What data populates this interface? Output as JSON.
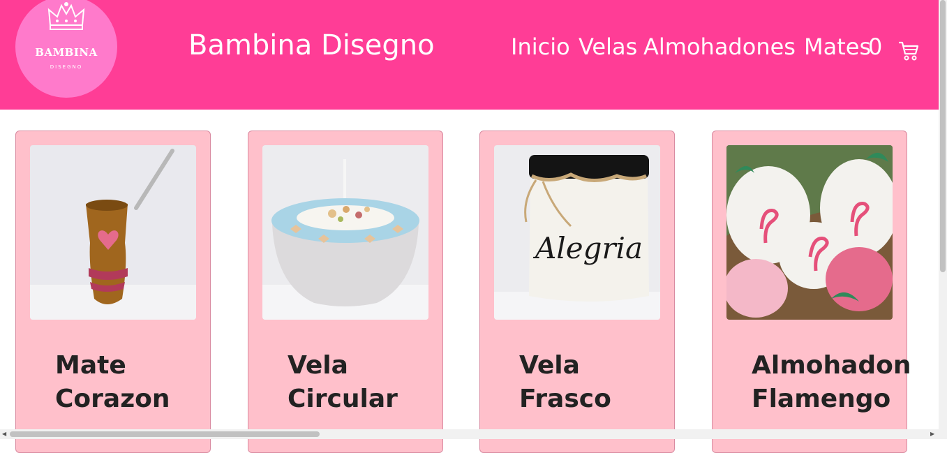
{
  "brand": {
    "logo_main": "BAMBINA",
    "logo_sub": "DISEGNO",
    "name": "Bambina Disegno"
  },
  "nav": {
    "items": [
      {
        "label": "Inicio"
      },
      {
        "label": "Velas"
      },
      {
        "label": "Almohadones"
      },
      {
        "label": "Mates"
      }
    ],
    "cart_count": "0",
    "cart_icon": "shopping-cart-icon"
  },
  "colors": {
    "header": "#ff3d96",
    "logo_circle": "#ff7acb",
    "card": "#ffc0cb"
  },
  "products": [
    {
      "name": "Mate Corazon"
    },
    {
      "name": "Vela Circular"
    },
    {
      "name": "Vela Frasco",
      "jar_label": "Alegria"
    },
    {
      "name": "Almohadon Flamengo"
    }
  ]
}
